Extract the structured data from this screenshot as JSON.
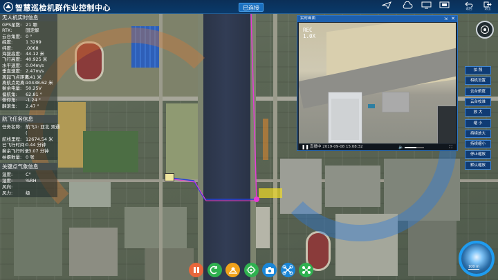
{
  "app": {
    "title": "智慧巡检机群作业控制中心",
    "connection_status": "已连接"
  },
  "toolbar_icons": [
    {
      "name": "send-icon",
      "label": ""
    },
    {
      "name": "cloud-icon",
      "label": ""
    },
    {
      "name": "monitor-icon",
      "label": ""
    },
    {
      "name": "screen-icon",
      "label": ""
    },
    {
      "name": "return-icon",
      "label": "返回"
    },
    {
      "name": "exit-icon",
      "label": "退出"
    }
  ],
  "uav_info": {
    "header": "无人机实时信息",
    "rows": [
      {
        "label": "GPS星数:",
        "value": "21 颗"
      },
      {
        "label": "RTK:",
        "value": "固定解"
      },
      {
        "label": "云台角度:",
        "value": "0 °"
      },
      {
        "label": "经度:",
        "value": "1      3299"
      },
      {
        "label": "纬度:",
        "value": ".0068"
      },
      {
        "label": "海拔高度:",
        "value": "44.12 米"
      },
      {
        "label": "飞行高度:",
        "value": "40.925 米"
      },
      {
        "label": "水平速度:",
        "value": "0.04m/s"
      },
      {
        "label": "垂直速度:",
        "value": "2.47m/s"
      },
      {
        "label": "离起飞点距离:",
        "value": "0.41 米"
      },
      {
        "label": "离航点距离:",
        "value": "10438.62 米"
      },
      {
        "label": "剩余电量:",
        "value": "50.25V"
      },
      {
        "label": "偏航角:",
        "value": "62.81 °"
      },
      {
        "label": "俯仰角:",
        "value": "-1.24 °"
      },
      {
        "label": "翻滚角:",
        "value": "2.47 °"
      }
    ]
  },
  "mission_info": {
    "header": "航飞任务信息",
    "rows": [
      {
        "label": "任务名称:",
        "value": "航飞1: 亚北 双通"
      },
      {
        "label": "",
        "value": "("
      },
      {
        "label": "航线里程:",
        "value": "12674.54 米"
      },
      {
        "label": "已飞行时间:",
        "value": "0.44 分钟"
      },
      {
        "label": "剩余飞行时长:",
        "value": "23.07 分钟"
      },
      {
        "label": "拍摄数量:",
        "value": "0 张"
      }
    ]
  },
  "weather_info": {
    "header": "关键点气象信息",
    "rows": [
      {
        "label": "温度:",
        "value": "C°"
      },
      {
        "label": "湿度:",
        "value": "%RH"
      },
      {
        "label": "风向:",
        "value": ""
      },
      {
        "label": "风力:",
        "value": "级"
      }
    ]
  },
  "video": {
    "title": "实时画面",
    "rec_label": "REC",
    "zoom_label": "1.0X",
    "timestamp": "直播中 2019-09-08 15:08:32",
    "volume_level": 0.6
  },
  "control_buttons": [
    "拍 照",
    "相机设置",
    "云台俯度",
    "云台校准",
    "放 大",
    "缩 小",
    "持续放大",
    "持续缩小",
    "停止缩放",
    "默认缩放"
  ],
  "map": {
    "scale_label": "100 m"
  },
  "bottom_actions": [
    {
      "name": "pause-button",
      "icon": "pause-icon",
      "color": "#e8663a"
    },
    {
      "name": "return-home-button",
      "icon": "return-icon",
      "color": "#2fb14f"
    },
    {
      "name": "takeoff-button",
      "icon": "takeoff-icon",
      "color": "#f0a21b"
    },
    {
      "name": "gimbal-button",
      "icon": "target-icon",
      "color": "#2fb14f"
    },
    {
      "name": "camera-button",
      "icon": "camera-icon",
      "color": "#1a86d8"
    },
    {
      "name": "mission-button",
      "icon": "drone-icon",
      "color": "#1a86d8"
    },
    {
      "name": "formation-button",
      "icon": "formation-icon",
      "color": "#2fb14f"
    }
  ]
}
